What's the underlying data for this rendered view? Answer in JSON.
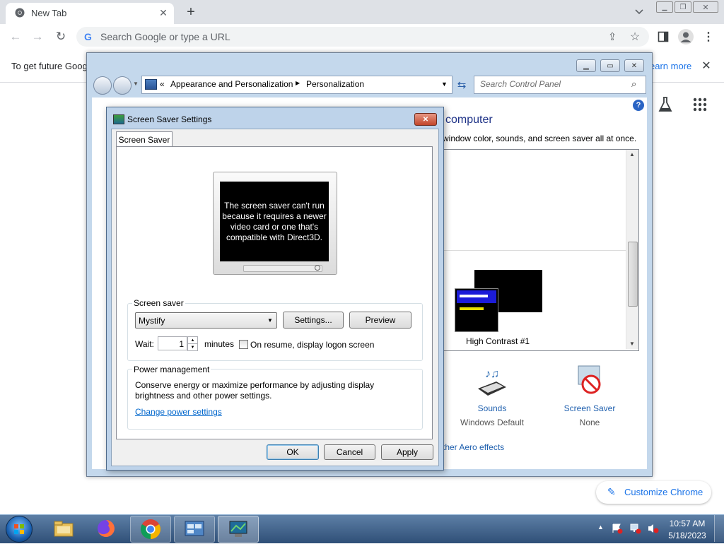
{
  "browser": {
    "tab_title": "New Tab",
    "omnibox_placeholder": "Search Google or type a URL",
    "infobar_text": "To get future Goog",
    "infobar_link": "earn more",
    "customize_label": "Customize Chrome"
  },
  "control_panel": {
    "breadcrumb_sep": "«",
    "breadcrumb": [
      "Appearance and Personalization",
      "Personalization"
    ],
    "search_placeholder": "Search Control Panel",
    "heading_partial": "computer",
    "desc_partial": "window color, sounds, and screen saver all at once.",
    "theme_name": "High Contrast #1",
    "sounds_label": "Sounds",
    "sounds_value": "Windows Default",
    "screensaver_label": "Screen Saver",
    "screensaver_value": "None",
    "aero_link": "ther Aero effects"
  },
  "dialog": {
    "title": "Screen Saver Settings",
    "tab": "Screen Saver",
    "preview_message": "The screen saver can't run because it requires a newer video card or one that's compatible with Direct3D.",
    "screensaver_group": "Screen saver",
    "screensaver_selected": "Mystify",
    "settings_button": "Settings...",
    "preview_button": "Preview",
    "wait_label": "Wait:",
    "wait_value": "1",
    "minutes_label": "minutes",
    "resume_label": "On resume, display logon screen",
    "resume_checked": false,
    "power_group": "Power management",
    "power_text": "Conserve energy or maximize performance by adjusting display brightness and other power settings.",
    "power_link": "Change power settings",
    "ok": "OK",
    "cancel": "Cancel",
    "apply": "Apply"
  },
  "taskbar": {
    "time": "10:57 AM",
    "date": "5/18/2023"
  }
}
